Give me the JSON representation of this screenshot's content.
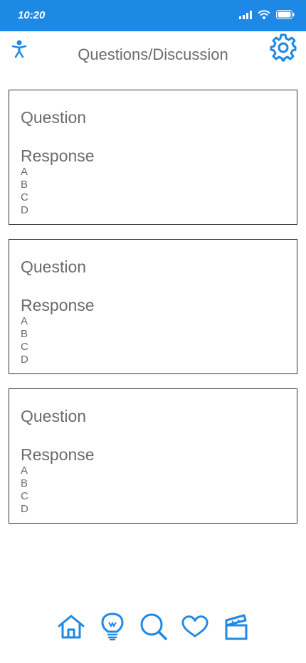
{
  "status_bar": {
    "time": "10:20",
    "icons": [
      "signal-icon",
      "wifi-icon",
      "battery-icon"
    ]
  },
  "header": {
    "title": "Questions/Discussion",
    "left_icon": "accessibility-icon",
    "right_icon": "gear-icon"
  },
  "cards": [
    {
      "question_label": "Question",
      "response_label": "Response",
      "options": [
        "A",
        "B",
        "C",
        "D"
      ]
    },
    {
      "question_label": "Question",
      "response_label": "Response",
      "options": [
        "A",
        "B",
        "C",
        "D"
      ]
    },
    {
      "question_label": "Question",
      "response_label": "Response",
      "options": [
        "A",
        "B",
        "C",
        "D"
      ]
    }
  ],
  "bottom_nav": {
    "items": [
      "home-icon",
      "lightbulb-icon",
      "search-icon",
      "heart-icon",
      "clapperboard-icon"
    ]
  },
  "colors": {
    "accent": "#1e88e5",
    "text": "#6b6b6b",
    "border": "#333333"
  }
}
